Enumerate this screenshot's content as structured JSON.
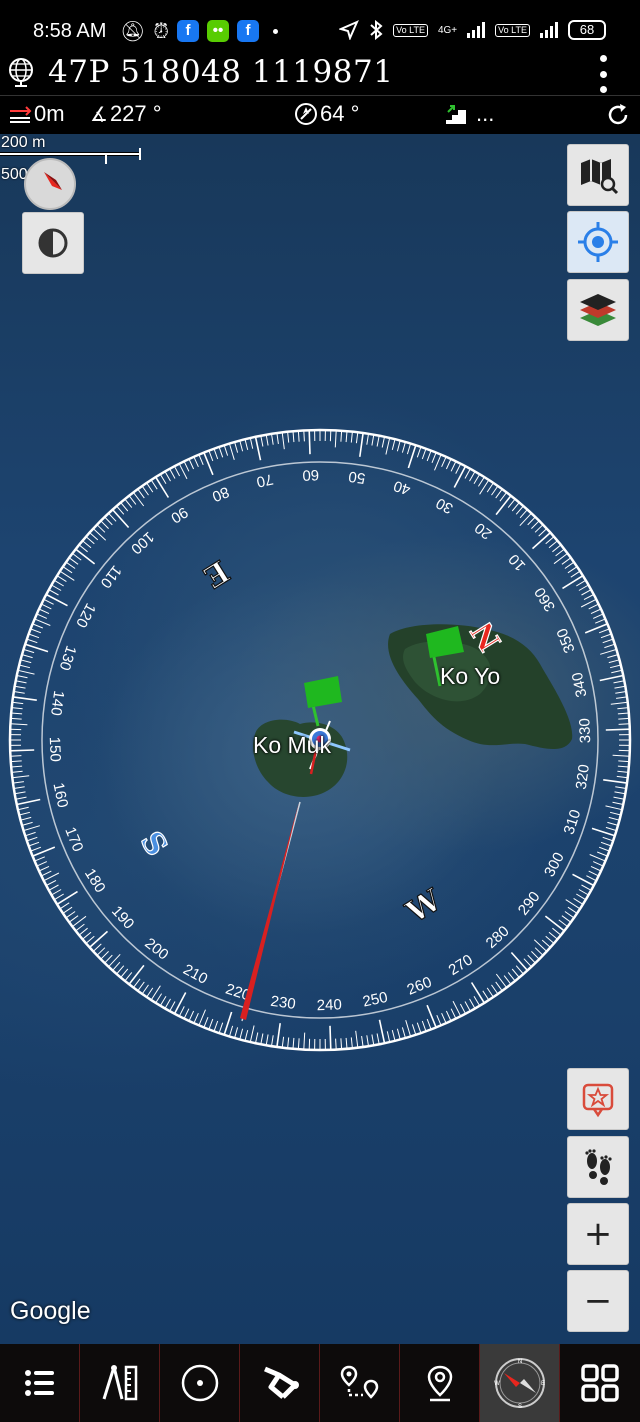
{
  "status_bar": {
    "time": "8:58 AM",
    "network": "4G+",
    "lte_badge": "Vo LTE",
    "battery": "68"
  },
  "header": {
    "coordinates": "47P 518048 1119871"
  },
  "info_bar": {
    "distance": "0m",
    "bearing": "227 °",
    "heading": "64 °",
    "altitude": "..."
  },
  "map": {
    "scale_metric": "200 m",
    "scale_imperial": "500 ft",
    "attribution": "Google",
    "places": [
      {
        "name": "Ko Muk"
      },
      {
        "name": "Ko Yo"
      }
    ],
    "compass": {
      "cardinal_labels": [
        "S",
        "W",
        "N",
        "E"
      ],
      "dial_labels": [
        "10",
        "20",
        "30",
        "40",
        "50",
        "60",
        "70",
        "80",
        "90",
        "100",
        "110",
        "120",
        "130",
        "140",
        "150",
        "160",
        "170",
        "180",
        "190",
        "200",
        "210",
        "220",
        "230",
        "240",
        "250",
        "260",
        "270",
        "280",
        "290",
        "300",
        "310",
        "320",
        "330",
        "340",
        "350",
        "360"
      ],
      "heading_marker": "64",
      "accent_colors": {
        "north": "#e8261e",
        "south": "#4a8fe0",
        "needle": "#d82020",
        "flag": "#2fc12f"
      }
    }
  },
  "toolbar_icons": {
    "map_search": "map-search-icon",
    "locate": "locate-icon",
    "layers": "layers-icon",
    "favorite": "star-icon",
    "track": "footprints-icon",
    "zoom_in": "+",
    "zoom_out": "−"
  },
  "bottom_nav": [
    {
      "icon": "list-icon"
    },
    {
      "icon": "measure-icon"
    },
    {
      "icon": "target-icon"
    },
    {
      "icon": "route-icon"
    },
    {
      "icon": "waypoints-route-icon"
    },
    {
      "icon": "location-pin-icon"
    },
    {
      "icon": "compass-icon",
      "active": true
    },
    {
      "icon": "grid-menu-icon"
    }
  ]
}
